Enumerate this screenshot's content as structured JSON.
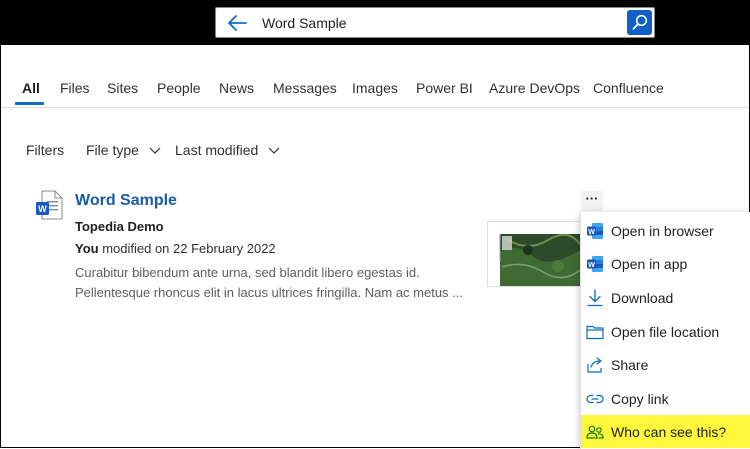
{
  "search": {
    "query": "Word Sample",
    "brand_color": "#0f5fc6"
  },
  "tabs": [
    {
      "label": "All",
      "active": true
    },
    {
      "label": "Files"
    },
    {
      "label": "Sites"
    },
    {
      "label": "People"
    },
    {
      "label": "News"
    },
    {
      "label": "Messages"
    },
    {
      "label": "Images"
    },
    {
      "label": "Power BI"
    },
    {
      "label": "Azure DevOps"
    },
    {
      "label": "Confluence"
    }
  ],
  "filters": {
    "label": "Filters",
    "file_type": "File type",
    "last_modified": "Last modified"
  },
  "result": {
    "title": "Word Sample",
    "site": "Topedia Demo",
    "modified_by": "You",
    "modified_text": " modified on 22 February 2022",
    "snippet_line1": "Curabitur bibendum ante urna, sed blandit libero egestas id.",
    "snippet_line2": "Pellentesque rhoncus elit in lacus ultrices fringilla. Nam ac metus ...",
    "more_label": "···"
  },
  "menu": {
    "items": [
      {
        "label": "Open in browser",
        "icon": "word-icon"
      },
      {
        "label": "Open in app",
        "icon": "word-icon"
      },
      {
        "label": "Download",
        "icon": "download-icon"
      },
      {
        "label": "Open file location",
        "icon": "folder-icon"
      },
      {
        "label": "Share",
        "icon": "share-icon"
      },
      {
        "label": "Copy link",
        "icon": "link-icon"
      },
      {
        "label": "Who can see this?",
        "icon": "people-icon",
        "highlight": "#fff73b"
      }
    ]
  }
}
